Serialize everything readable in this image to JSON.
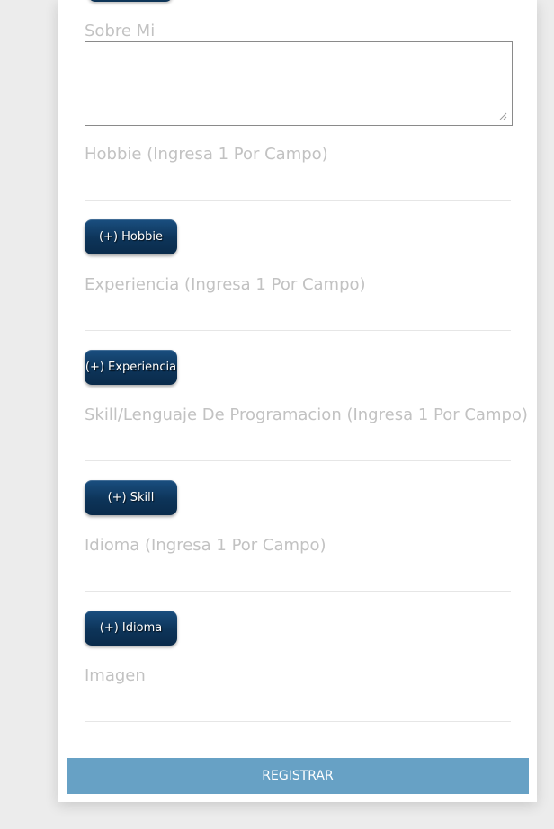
{
  "form": {
    "about_label": "Sobre Mi",
    "about_value": "",
    "sections": [
      {
        "label": "Hobbie (Ingresa 1 Por Campo)",
        "value": "",
        "button": "(+) Hobbie"
      },
      {
        "label": "Experiencia (Ingresa 1 Por Campo)",
        "value": "",
        "button": "(+) Experiencia"
      },
      {
        "label": "Skill/Lenguaje De Programacion (Ingresa 1 Por Campo)",
        "value": "",
        "button": "(+) Skill"
      },
      {
        "label": "Idioma (Ingresa 1 Por Campo)",
        "value": "",
        "button": "(+) Idioma"
      }
    ],
    "image_label": "Imagen",
    "image_value": "",
    "submit_label": "REGISTRAR"
  },
  "colors": {
    "page_background": "#ececec",
    "card_background": "#ffffff",
    "label_text": "#c2c2c2",
    "add_button": "#0d3459",
    "submit_button": "#67a1c5"
  }
}
